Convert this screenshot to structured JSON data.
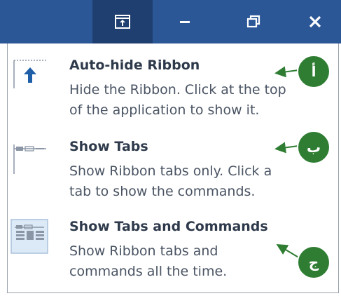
{
  "titlebar": {
    "buttons": [
      {
        "name": "ribbon-display-options-icon"
      },
      {
        "name": "minimize-icon"
      },
      {
        "name": "restore-icon"
      },
      {
        "name": "close-icon"
      }
    ]
  },
  "options": [
    {
      "title": "Auto-hide Ribbon",
      "desc_line1": "Hide the Ribbon. Click at the top",
      "desc_line2": "of the application to show it.",
      "marker": "أ"
    },
    {
      "title": "Show Tabs",
      "desc_line1": "Show Ribbon tabs only. Click a",
      "desc_line2": "tab to show the commands.",
      "marker": "ب"
    },
    {
      "title": "Show Tabs and Commands",
      "desc_line1": "Show Ribbon tabs and",
      "desc_line2": "commands all the time.",
      "marker": "ج"
    }
  ],
  "colors": {
    "titlebar": "#2b5797",
    "active_button": "#1f3f70",
    "marker": "#2e7d32"
  }
}
